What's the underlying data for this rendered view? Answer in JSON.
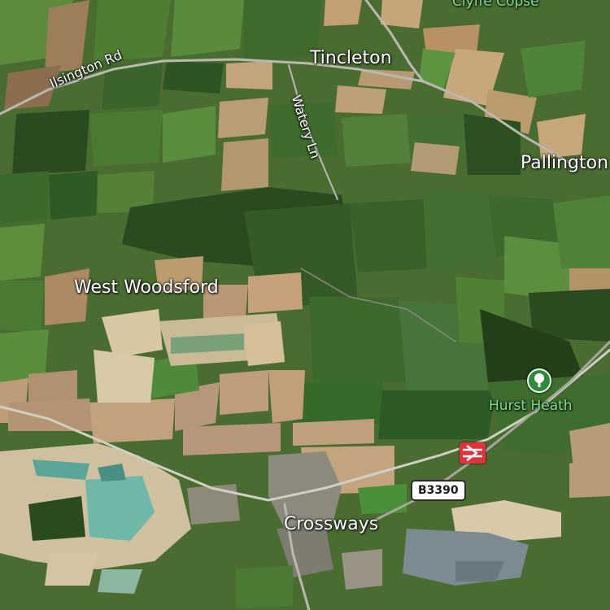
{
  "map": {
    "places": {
      "clyffe_copse": "Clyffe Copse",
      "tincleton": "Tincleton",
      "pallington": "Pallington",
      "west_woodsford": "West Woodsford",
      "crossways": "Crossways",
      "hurst_heath": "Hurst Heath"
    },
    "roads": {
      "ilsington_rd": "Ilsington Rd",
      "watery_ln": "Watery Ln",
      "b3390": "B3390"
    },
    "icons": {
      "railway_station": "railway-station-icon",
      "park": "tree-icon"
    },
    "colors": {
      "field_green": "#4f7a34",
      "dark_wood": "#243c1c",
      "bare_field": "#b89a72",
      "quarry": "#d8c9a8",
      "water": "#6fb7a8",
      "road": "#b9b9b2",
      "rail_badge": "#e0323a",
      "park_label": "#7de08a"
    }
  }
}
